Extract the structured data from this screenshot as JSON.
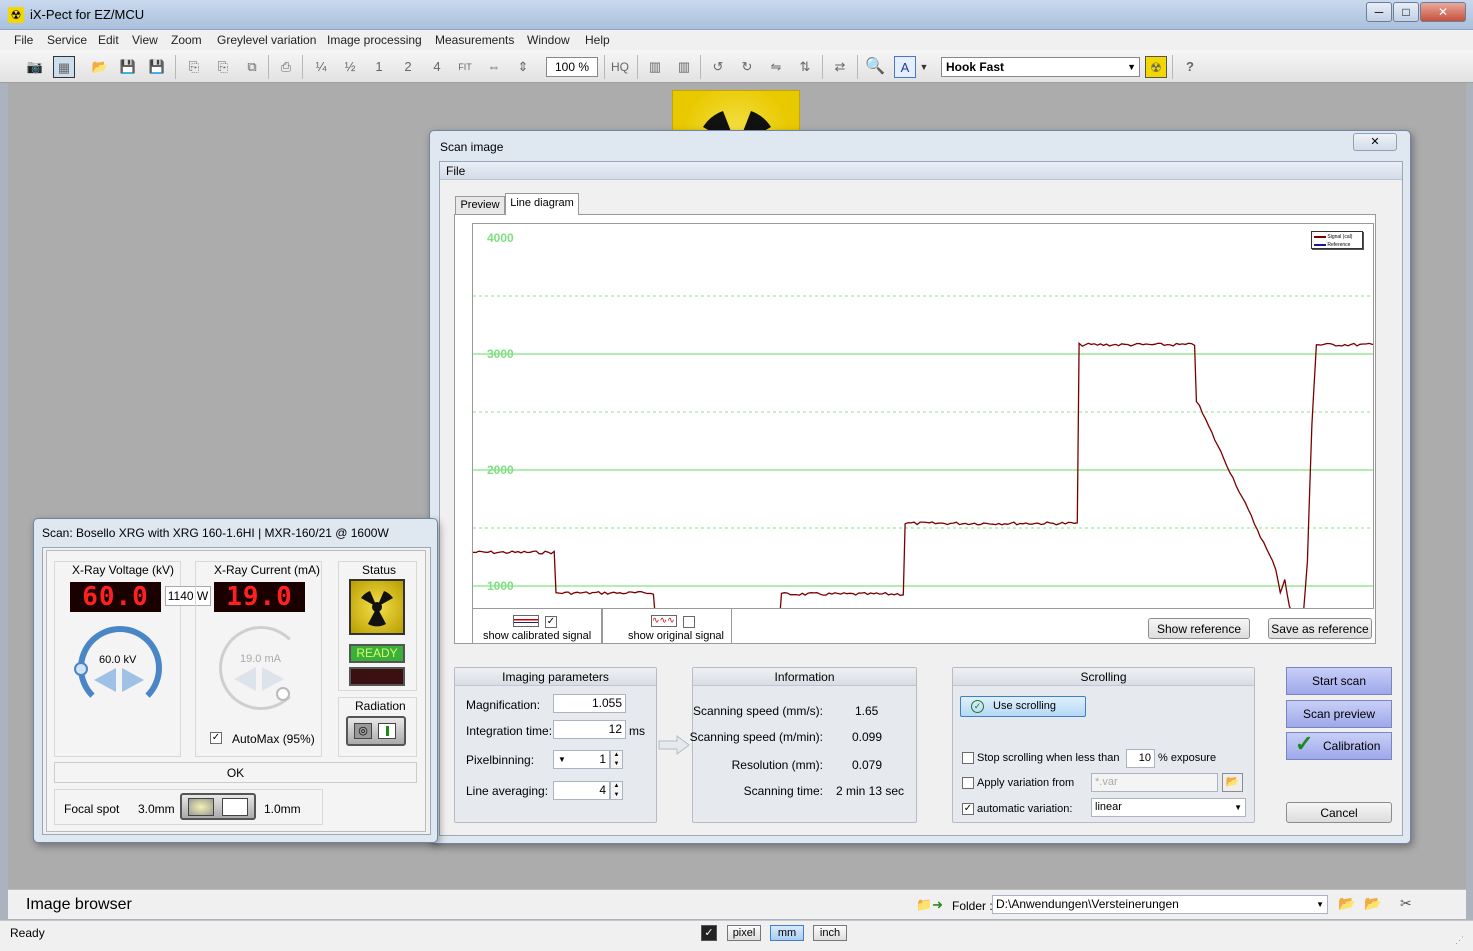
{
  "app": {
    "title": "iX-Pect for EZ/MCU"
  },
  "window_controls": {
    "minimize": "─",
    "maximize": "□",
    "close": "✕"
  },
  "menu": [
    "File",
    "Service",
    "Edit",
    "View",
    "Zoom",
    "Greylevel variation",
    "Image processing",
    "Measurements",
    "Window",
    "Help"
  ],
  "toolbar": {
    "zoom": "100 %",
    "hq": "HQ",
    "profile_value": "Hook  Fast"
  },
  "scan_dialog": {
    "title": "Scan image",
    "menu_file": "File",
    "tabs": [
      "Preview",
      "Line diagram"
    ],
    "legend": {
      "signal": "Signal (cal)",
      "reference": "Reference"
    },
    "show_calibrated": "show calibrated signal",
    "show_original": "show original signal",
    "show_reference": "Show reference",
    "save_reference": "Save as reference",
    "imaging": {
      "title": "Imaging parameters",
      "magnification_label": "Magnification:",
      "magnification": "1.055",
      "integration_label": "Integration time:",
      "integration": "12",
      "integration_unit": "ms",
      "pixelbinning_label": "Pixelbinning:",
      "pixelbinning": "1",
      "averaging_label": "Line averaging:",
      "averaging": "4"
    },
    "information": {
      "title": "Information",
      "rows": [
        {
          "label": "Scanning speed (mm/s):",
          "value": "1.65"
        },
        {
          "label": "Scanning speed (m/min):",
          "value": "0.099"
        },
        {
          "label": "Resolution (mm):",
          "value": "0.079"
        },
        {
          "label": "Scanning time:",
          "value": "2 min 13 sec"
        }
      ]
    },
    "scrolling": {
      "title": "Scrolling",
      "use_scrolling": "Use scrolling",
      "stop_label": "Stop scrolling when less than",
      "stop_value": "10",
      "stop_unit": "% exposure",
      "apply_label": "Apply variation from",
      "apply_placeholder": "*.var",
      "auto_label": "automatic variation:",
      "auto_value": "linear"
    },
    "start_scan": "Start scan",
    "scan_preview": "Scan preview",
    "calibration": "Calibration",
    "cancel": "Cancel"
  },
  "xray": {
    "title": "Scan: Bosello XRG with XRG 160-1.6HI  |  MXR-160/21 @ 1600W",
    "voltage_label": "X-Ray Voltage (kV)",
    "voltage_display": "60.0",
    "voltage_knob": "60.0 kV",
    "power": "1140 W",
    "current_label": "X-Ray Current (mA)",
    "current_display": "19.0",
    "current_knob": "19.0 mA",
    "status_label": "Status",
    "ready": "READY",
    "radiation_label": "Radiation",
    "automax": "AutoMax (95%)",
    "ok": "OK",
    "focal_label": "Focal spot",
    "focal_a": "3.0mm",
    "focal_b": "1.0mm"
  },
  "browser": {
    "title": "Image browser",
    "folder_label": "Folder :",
    "folder": "D:\\Anwendungen\\Versteinerungen"
  },
  "statusbar": {
    "text": "Ready",
    "units": [
      "pixel",
      "mm",
      "inch"
    ]
  },
  "chart_data": {
    "type": "line",
    "title": "",
    "xlabel": "",
    "ylabel": "",
    "ylim": [
      0,
      4000
    ],
    "y_ticks": [
      "1000",
      "2000",
      "3000",
      "4000"
    ],
    "grid": true,
    "legend": "top-right",
    "colors": {
      "signal": "#7a0000",
      "reference": "#1a1a8a",
      "grid": "#66dd66"
    },
    "series": [
      {
        "name": "Signal (cal)",
        "x": [
          0,
          0.09,
          0.092,
          0.2,
          0.202,
          0.34,
          0.342,
          0.477,
          0.479,
          0.67,
          0.672,
          0.8,
          0.802,
          0.89,
          0.895,
          0.9,
          0.905,
          0.91,
          0.915,
          0.92,
          0.925,
          0.93,
          0.935,
          0.94,
          0.95,
          1.0
        ],
        "y": [
          1290,
          1290,
          940,
          940,
          740,
          740,
          930,
          930,
          1540,
          1540,
          3080,
          3080,
          2600,
          1150,
          950,
          1050,
          820,
          740,
          680,
          700,
          1200,
          2400,
          3080,
          3080,
          3080,
          3080
        ]
      }
    ]
  }
}
